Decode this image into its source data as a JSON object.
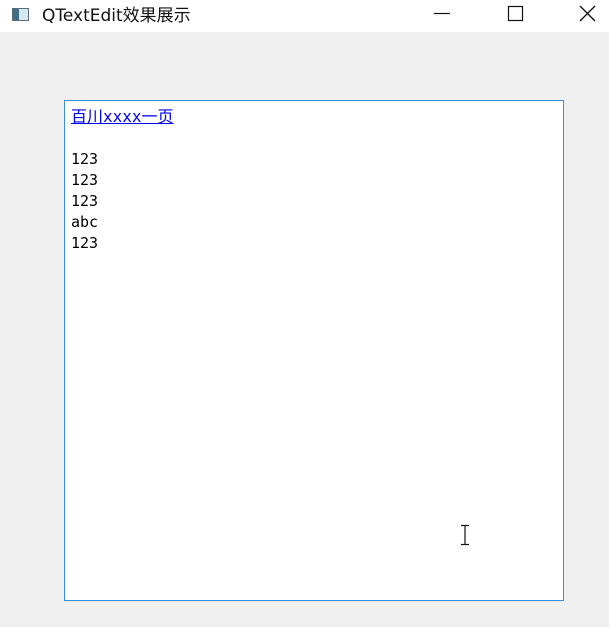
{
  "window": {
    "title": "QTextEdit效果展示",
    "icons": {
      "app": "app-window-icon",
      "minimize": "minimize-icon",
      "maximize": "maximize-icon",
      "close": "close-icon",
      "cursor": "text-cursor-icon"
    }
  },
  "text_edit": {
    "link_text": "百川xxxx一页",
    "lines": [
      "123",
      "123",
      "123",
      "abc",
      "123"
    ]
  },
  "colors": {
    "link": "#0000ee",
    "border": "#3c8fd6",
    "background": "#f0f0f0"
  }
}
